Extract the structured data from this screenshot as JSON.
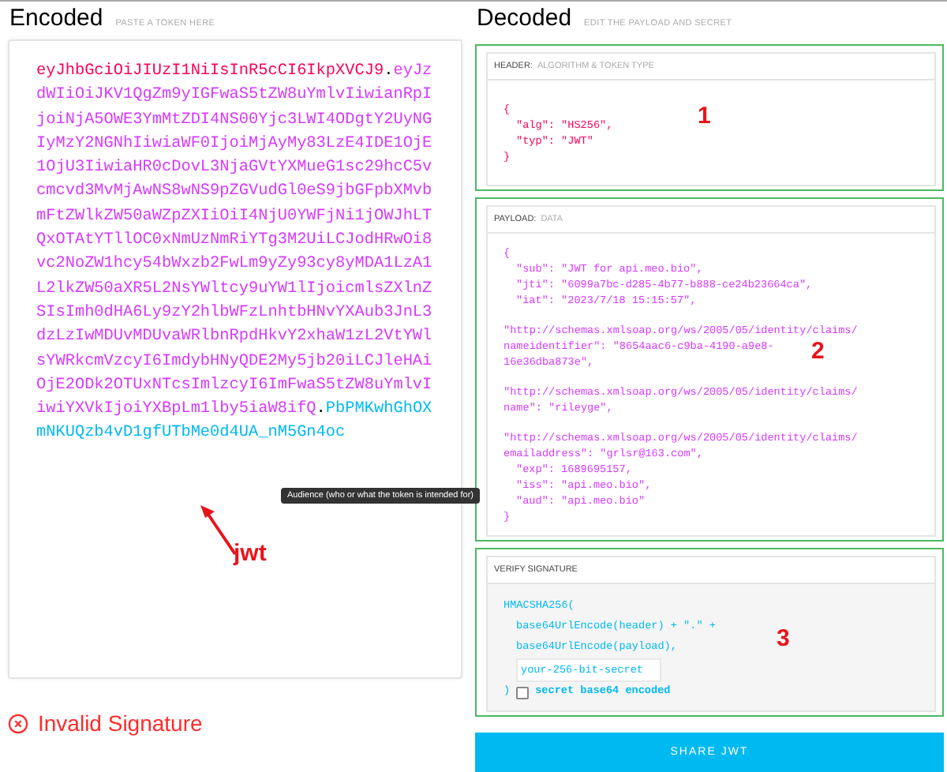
{
  "encoded": {
    "title": "Encoded",
    "subtitle": "PASTE A TOKEN HERE",
    "token": [
      {
        "kind": "header",
        "text": "eyJhbGciOiJIUzI1NiIsInR5cCI6IkpXVCJ9"
      },
      {
        "kind": "dot",
        "text": "."
      },
      {
        "kind": "payload",
        "text": "eyJzdWIiOiJKV1QgZm9yIGFwaS5tZW8uYmlvIiwianRpIjoiNjA5OWE3YmMtZDI4NS00Yjc3LWI4ODgtY2UyNGIyMzY2NGNhIiwiaWF0IjoiMjAyMy83LzE4IDE1OjE1OjU3IiwiaHR0cDovL3NjaGVtYXMueG1sc29hcC5vcmcvd3MvMjAwNS8wNS9pZGVudGl0eS9jbGFpbXMvbmFtZWlkZW50aWZpZXIiOiI4NjU0YWFjNi1jOWJhLTQxOTAtYTllOC0xNmUzNmRiYTg3M2UiLCJodHRwOi8vc2NoZW1hcy54bWxzb2FwLm9yZy93cy8yMDA1LzA1L2lkZW50aXR5L2NsYWltcy9uYW1lIjoicmlsZXlnZSIsImh0dHA6Ly9zY2hlbWFzLnhtbHNvYXAub3JnL3dzLzIwMDUvMDUvaWRlbnRpdHkvY2xhaW1zL2VtYWlsYWRkcmVzcyI6ImdybHNyQDE2My5jb20iLCJleHAiOjE2ODk2OTUxNTcsImlzcyI6ImFwaS5tZW8uYmlvIiwiYXVkIjoiYXBpLm1lby5iaW8ifQ"
      },
      {
        "kind": "dot",
        "text": "."
      },
      {
        "kind": "signature",
        "text": "PbPMKwhGhOXmNKUQzb4vD1gfUTbMe0d4UA_nM5Gn4oc"
      }
    ],
    "status": "Invalid Signature"
  },
  "decoded": {
    "title": "Decoded",
    "subtitle": "EDIT THE PAYLOAD AND SECRET",
    "header": {
      "label": "HEADER:",
      "sublabel": "ALGORITHM & TOKEN TYPE",
      "lines": [
        {
          "text": "{",
          "indent": false
        },
        {
          "text": "\"alg\": \"HS256\",",
          "indent": true
        },
        {
          "text": "\"typ\": \"JWT\"",
          "indent": true
        },
        {
          "text": "}",
          "indent": false
        }
      ]
    },
    "payload": {
      "label": "PAYLOAD:",
      "sublabel": "DATA",
      "blocks": [
        {
          "lines": [
            {
              "text": "{",
              "indent": false
            },
            {
              "text": "\"sub\": \"JWT for api.meo.bio\",",
              "indent": true
            },
            {
              "text": "\"jti\": \"6099a7bc-d285-4b77-b888-ce24b23664ca\",",
              "indent": true
            },
            {
              "text": "\"iat\": \"2023/7/18 15:15:57\",",
              "indent": true
            }
          ]
        },
        {
          "lines": [
            {
              "text": "\"http://schemas.xmlsoap.org/ws/2005/05/identity/claims/",
              "indent": false
            },
            {
              "text": "nameidentifier\": \"8654aac6-c9ba-4190-a9e8-",
              "indent": false
            },
            {
              "text": "16e36dba873e\",",
              "indent": false
            }
          ]
        },
        {
          "lines": [
            {
              "text": "\"http://schemas.xmlsoap.org/ws/2005/05/identity/claims/",
              "indent": false
            },
            {
              "text": "name\": \"rileyge\",",
              "indent": false
            }
          ]
        },
        {
          "lines": [
            {
              "text": "\"http://schemas.xmlsoap.org/ws/2005/05/identity/claims/",
              "indent": false
            },
            {
              "text": "emailaddress\": \"grlsr@163.com\",",
              "indent": false
            },
            {
              "text": "\"exp\": 1689695157,",
              "indent": true
            },
            {
              "text": "\"iss\": \"api.meo.bio\",",
              "indent": true
            },
            {
              "text": "\"aud\": \"api.meo.bio\"",
              "indent": true
            },
            {
              "text": "}",
              "indent": false
            }
          ]
        }
      ]
    },
    "verify": {
      "label": "VERIFY SIGNATURE",
      "func": "HMACSHA256(",
      "arg1": "base64UrlEncode(header) + \".\" +",
      "arg2": "base64UrlEncode(payload),",
      "secret_placeholder": "your-256-bit-secret",
      "close": ")",
      "base64": {
        "label": "secret base64 encoded",
        "checked": false
      }
    },
    "share_button": "SHARE JWT"
  },
  "tooltip": "Audience (who or what the token is intended for)",
  "annotations": [
    {
      "kind": "number",
      "text": "1"
    },
    {
      "kind": "number",
      "text": "2"
    },
    {
      "kind": "number",
      "text": "3"
    },
    {
      "kind": "arrow",
      "text": "jwt"
    }
  ]
}
